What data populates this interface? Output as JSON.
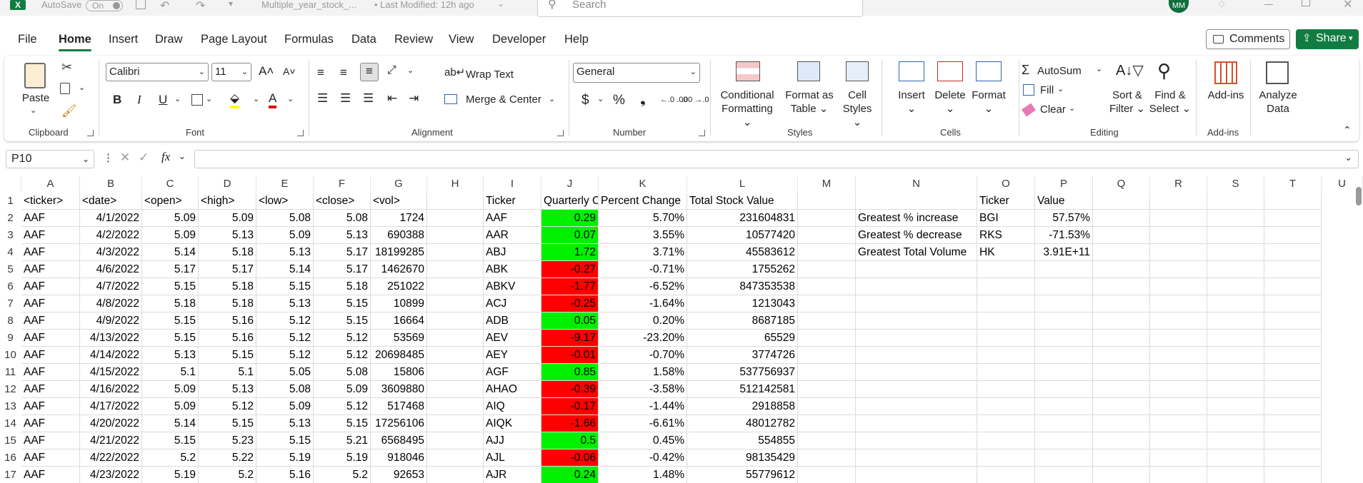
{
  "titlebar": {
    "autosave_label": "AutoSave",
    "autosave_state": "On",
    "filename": "Multiple_year_stock_...",
    "modified": "• Last Modified: 12h ago",
    "search_placeholder": "Search",
    "user_initials": "MM"
  },
  "menu": [
    "File",
    "Home",
    "Insert",
    "Draw",
    "Page Layout",
    "Formulas",
    "Data",
    "Review",
    "View",
    "Developer",
    "Help"
  ],
  "menu_active": "Home",
  "comments_label": "Comments",
  "share_label": "Share",
  "ribbon": {
    "clipboard": {
      "paste": "Paste",
      "label": "Clipboard"
    },
    "font": {
      "name": "Calibri",
      "size": "11",
      "label": "Font",
      "bold": "B",
      "italic": "I",
      "underline": "U"
    },
    "alignment": {
      "wrap": "Wrap Text",
      "merge": "Merge & Center",
      "label": "Alignment"
    },
    "number": {
      "format": "General",
      "label": "Number",
      "currency": "$",
      "percent": "%",
      "comma": "❟"
    },
    "styles": {
      "conditional": "Conditional",
      "conditional2": "Formatting",
      "format_table": "Format as",
      "format_table2": "Table",
      "cell_styles": "Cell",
      "cell_styles2": "Styles",
      "label": "Styles"
    },
    "cells": {
      "insert": "Insert",
      "delete": "Delete",
      "format": "Format",
      "label": "Cells"
    },
    "editing": {
      "autosum": "AutoSum",
      "fill": "Fill",
      "clear": "Clear",
      "sort": "Sort &",
      "sort2": "Filter",
      "find": "Find &",
      "find2": "Select",
      "label": "Editing"
    },
    "addins": {
      "addins": "Add-ins",
      "label": "Add-ins"
    },
    "analyze": {
      "line1": "Analyze",
      "line2": "Data"
    }
  },
  "namebox": "P10",
  "columns": [
    "A",
    "B",
    "C",
    "D",
    "E",
    "F",
    "G",
    "H",
    "I",
    "J",
    "K",
    "L",
    "M",
    "N",
    "O",
    "P",
    "Q",
    "R",
    "S",
    "T",
    "U"
  ],
  "rows": [
    [
      "<ticker>",
      "<date>",
      "<open>",
      "<high>",
      "<low>",
      "<close>",
      "<vol>",
      "",
      "Ticker",
      "Quarterly C",
      "Percent Change",
      "Total Stock Value",
      "",
      "",
      "Ticker",
      "Value"
    ],
    [
      "AAF",
      "4/1/2022",
      "5.09",
      "5.09",
      "5.08",
      "5.08",
      "1724",
      "",
      "AAF",
      "0.29",
      "5.70%",
      "231604831",
      "",
      "Greatest % increase",
      "BGI",
      "57.57%"
    ],
    [
      "AAF",
      "4/2/2022",
      "5.09",
      "5.13",
      "5.09",
      "5.13",
      "690388",
      "",
      "AAR",
      "0.07",
      "3.55%",
      "10577420",
      "",
      "Greatest % decrease",
      "RKS",
      "-71.53%"
    ],
    [
      "AAF",
      "4/3/2022",
      "5.14",
      "5.18",
      "5.13",
      "5.17",
      "18199285",
      "",
      "ABJ",
      "1.72",
      "3.71%",
      "45583612",
      "",
      "Greatest Total Volume",
      "HK",
      "3.91E+11"
    ],
    [
      "AAF",
      "4/6/2022",
      "5.17",
      "5.17",
      "5.14",
      "5.17",
      "1462670",
      "",
      "ABK",
      "-0.27",
      "-0.71%",
      "1755262",
      "",
      "",
      "",
      ""
    ],
    [
      "AAF",
      "4/7/2022",
      "5.15",
      "5.18",
      "5.15",
      "5.18",
      "251022",
      "",
      "ABKV",
      "-1.77",
      "-6.52%",
      "847353538",
      "",
      "",
      "",
      ""
    ],
    [
      "AAF",
      "4/8/2022",
      "5.18",
      "5.18",
      "5.13",
      "5.15",
      "10899",
      "",
      "ACJ",
      "-0.25",
      "-1.64%",
      "1213043",
      "",
      "",
      "",
      ""
    ],
    [
      "AAF",
      "4/9/2022",
      "5.15",
      "5.16",
      "5.12",
      "5.15",
      "16664",
      "",
      "ADB",
      "0.05",
      "0.20%",
      "8687185",
      "",
      "",
      "",
      ""
    ],
    [
      "AAF",
      "4/13/2022",
      "5.15",
      "5.16",
      "5.12",
      "5.12",
      "53569",
      "",
      "AEV",
      "-9.17",
      "-23.20%",
      "65529",
      "",
      "",
      "",
      ""
    ],
    [
      "AAF",
      "4/14/2022",
      "5.13",
      "5.15",
      "5.12",
      "5.12",
      "20698485",
      "",
      "AEY",
      "-0.01",
      "-0.70%",
      "3774726",
      "",
      "",
      "",
      ""
    ],
    [
      "AAF",
      "4/15/2022",
      "5.1",
      "5.1",
      "5.05",
      "5.08",
      "15806",
      "",
      "AGF",
      "0.85",
      "1.58%",
      "537756937",
      "",
      "",
      "",
      ""
    ],
    [
      "AAF",
      "4/16/2022",
      "5.09",
      "5.13",
      "5.08",
      "5.09",
      "3609880",
      "",
      "AHAO",
      "-0.39",
      "-3.58%",
      "512142581",
      "",
      "",
      "",
      ""
    ],
    [
      "AAF",
      "4/17/2022",
      "5.09",
      "5.12",
      "5.09",
      "5.12",
      "517468",
      "",
      "AIQ",
      "-0.17",
      "-1.44%",
      "2918858",
      "",
      "",
      "",
      ""
    ],
    [
      "AAF",
      "4/20/2022",
      "5.14",
      "5.15",
      "5.13",
      "5.15",
      "17256106",
      "",
      "AIQK",
      "-1.66",
      "-6.61%",
      "48012782",
      "",
      "",
      "",
      ""
    ],
    [
      "AAF",
      "4/21/2022",
      "5.15",
      "5.23",
      "5.15",
      "5.21",
      "6568495",
      "",
      "AJJ",
      "0.5",
      "0.45%",
      "554855",
      "",
      "",
      "",
      ""
    ],
    [
      "AAF",
      "4/22/2022",
      "5.2",
      "5.22",
      "5.19",
      "5.19",
      "918046",
      "",
      "AJL",
      "-0.06",
      "-0.42%",
      "98135429",
      "",
      "",
      "",
      ""
    ],
    [
      "AAF",
      "4/23/2022",
      "5.19",
      "5.2",
      "5.16",
      "5.2",
      "92653",
      "",
      "AJR",
      "0.24",
      "1.48%",
      "55779612",
      "",
      "",
      "",
      ""
    ]
  ],
  "colors": {
    "positive": "#00f000",
    "negative": "#ff0000",
    "excel_green": "#107c41"
  }
}
